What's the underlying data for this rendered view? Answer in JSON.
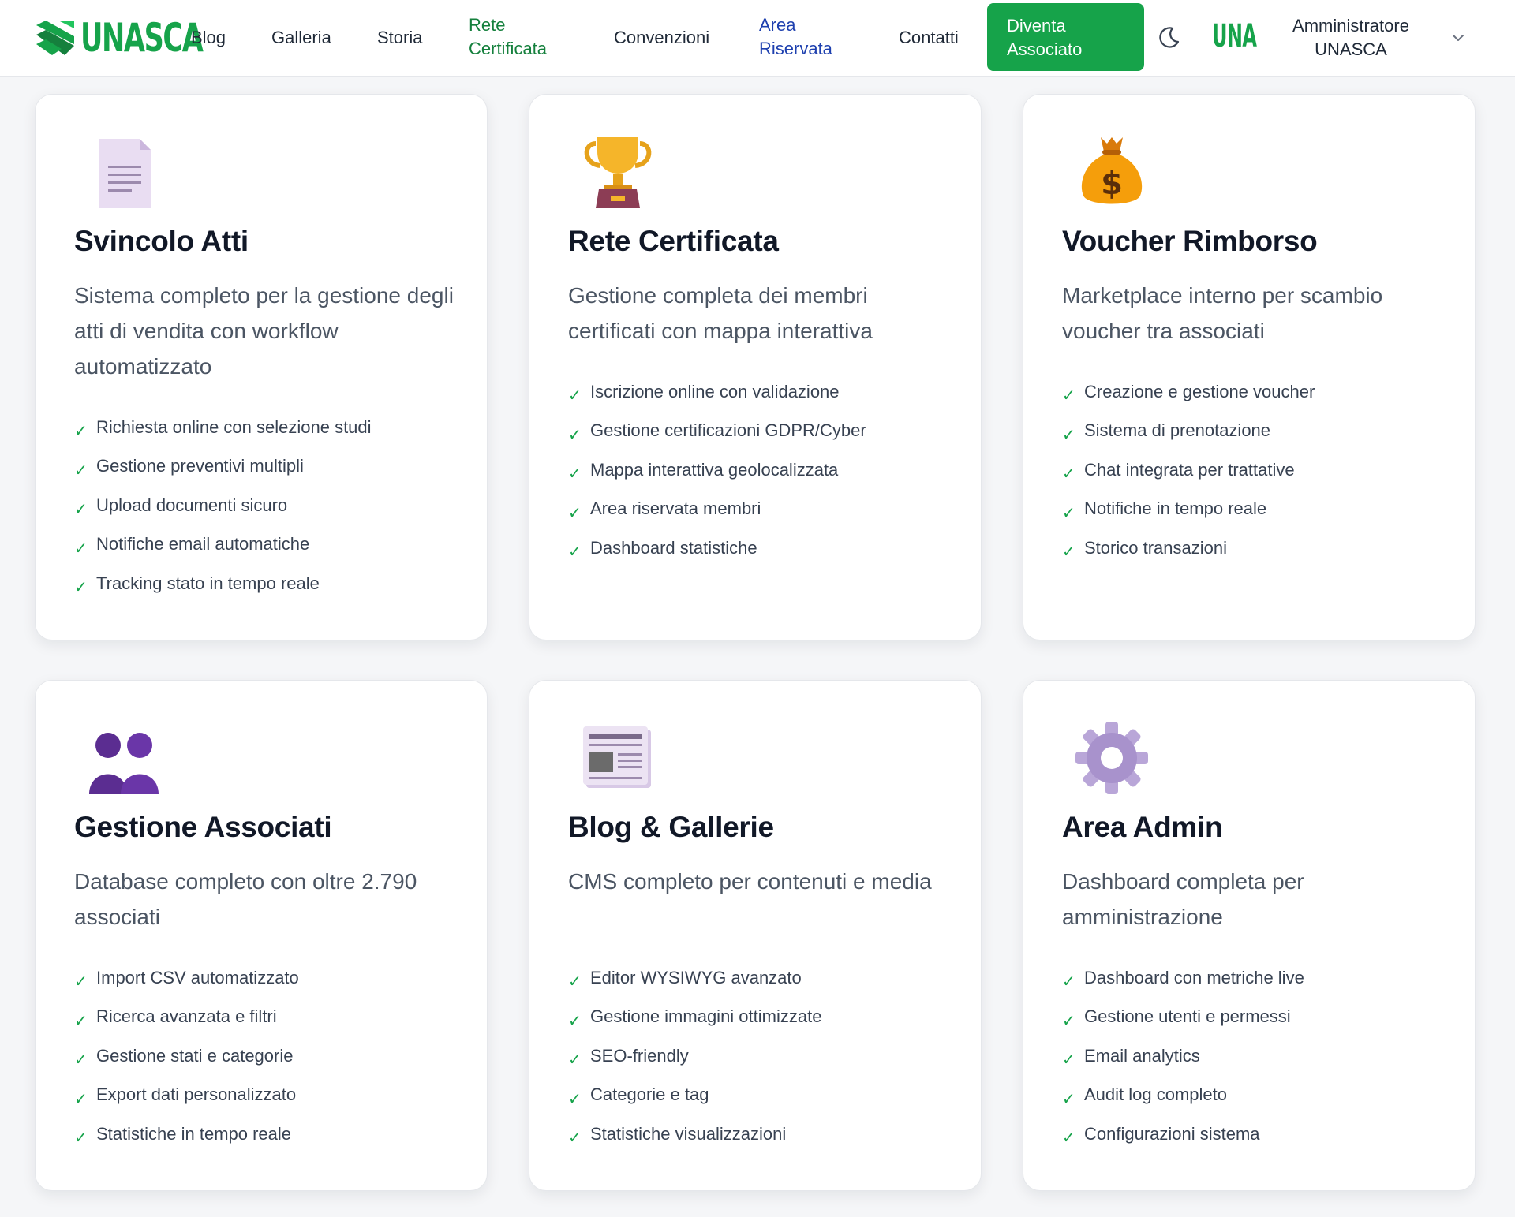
{
  "brand": {
    "name": "UNASCA",
    "secondary_logo": "UNA",
    "accent": "#16a34a"
  },
  "nav": {
    "links": [
      {
        "label": "Blog"
      },
      {
        "label": "Galleria"
      },
      {
        "label": "Storia"
      },
      {
        "label": "Rete Certificata"
      },
      {
        "label": "Convenzioni"
      },
      {
        "label": "Area Riservata"
      },
      {
        "label": "Contatti"
      }
    ],
    "cta_label": "Diventa Associato",
    "theme_toggle_icon": "moon-icon",
    "user_label": "Amministratore UNASCA",
    "user_menu_icon": "chevron-down-icon"
  },
  "cards": [
    {
      "icon": "document-icon",
      "title": "Svincolo Atti",
      "description": "Sistema completo per la gestione degli atti di vendita con workflow automatizzato",
      "features": [
        "Richiesta online con selezione studi",
        "Gestione preventivi multipli",
        "Upload documenti sicuro",
        "Notifiche email automatiche",
        "Tracking stato in tempo reale"
      ]
    },
    {
      "icon": "trophy-icon",
      "title": "Rete Certificata",
      "description": "Gestione completa dei membri certificati con mappa interattiva",
      "features": [
        "Iscrizione online con validazione",
        "Gestione certificazioni GDPR/Cyber",
        "Mappa interattiva geolocalizzata",
        "Area riservata membri",
        "Dashboard statistiche"
      ]
    },
    {
      "icon": "money-bag-icon",
      "title": "Voucher Rimborso",
      "description": "Marketplace interno per scambio voucher tra associati",
      "features": [
        "Creazione e gestione voucher",
        "Sistema di prenotazione",
        "Chat integrata per trattative",
        "Notifiche in tempo reale",
        "Storico transazioni"
      ]
    },
    {
      "icon": "users-icon",
      "title": "Gestione Associati",
      "description": "Database completo con oltre 2.790 associati",
      "features": [
        "Import CSV automatizzato",
        "Ricerca avanzata e filtri",
        "Gestione stati e categorie",
        "Export dati personalizzato",
        "Statistiche in tempo reale"
      ]
    },
    {
      "icon": "newspaper-icon",
      "title": "Blog & Gallerie",
      "description": "CMS completo per contenuti e media",
      "features": [
        "Editor WYSIWYG avanzato",
        "Gestione immagini ottimizzate",
        "SEO-friendly",
        "Categorie e tag",
        "Statistiche visualizzazioni"
      ]
    },
    {
      "icon": "gear-icon",
      "title": "Area Admin",
      "description": "Dashboard completa per amministrazione",
      "features": [
        "Dashboard con metriche live",
        "Gestione utenti e permessi",
        "Email analytics",
        "Audit log completo",
        "Configurazioni sistema"
      ]
    }
  ]
}
